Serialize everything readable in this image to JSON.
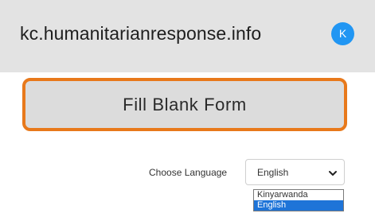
{
  "header": {
    "site_title": "kc.humanitarianresponse.info",
    "avatar_letter": "K",
    "avatar_color": "#2196f3"
  },
  "main": {
    "fill_button_label": "Fill Blank Form",
    "highlight_color": "#e8791b"
  },
  "language": {
    "label": "Choose Language",
    "selected": "English",
    "options": [
      {
        "label": "Kinyarwanda",
        "selected": false
      },
      {
        "label": "English",
        "selected": true
      }
    ],
    "selected_color": "#1e74d8"
  }
}
